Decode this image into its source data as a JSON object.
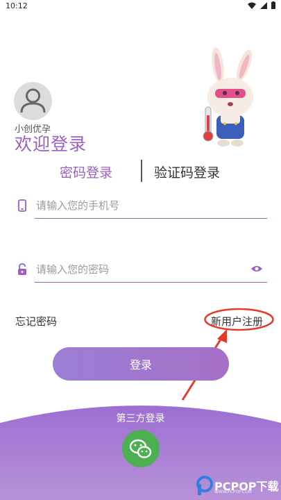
{
  "status_bar": {
    "time": "10:12",
    "icons": [
      "wifi-icon",
      "signal-icon",
      "battery-icon"
    ]
  },
  "header": {
    "app_name": "小创优孕",
    "welcome": "欢迎登录"
  },
  "tabs": {
    "password_login": "密码登录",
    "code_login": "验证码登录",
    "active": "password_login"
  },
  "form": {
    "phone_placeholder": "请输入您的手机号",
    "password_placeholder": "请输入您的密码"
  },
  "links": {
    "forgot_password": "忘记密码",
    "register": "新用户注册"
  },
  "login_button": "登录",
  "third_party": {
    "label": "第三方登录",
    "providers": [
      "wechat-icon"
    ]
  },
  "watermark": {
    "text": "PCPOP下载",
    "sub": "WWW.PCPOP.COM"
  },
  "colors": {
    "accent": "#9a5fc0",
    "highlight": "#e53a2a",
    "wechat": "#4caf50"
  }
}
